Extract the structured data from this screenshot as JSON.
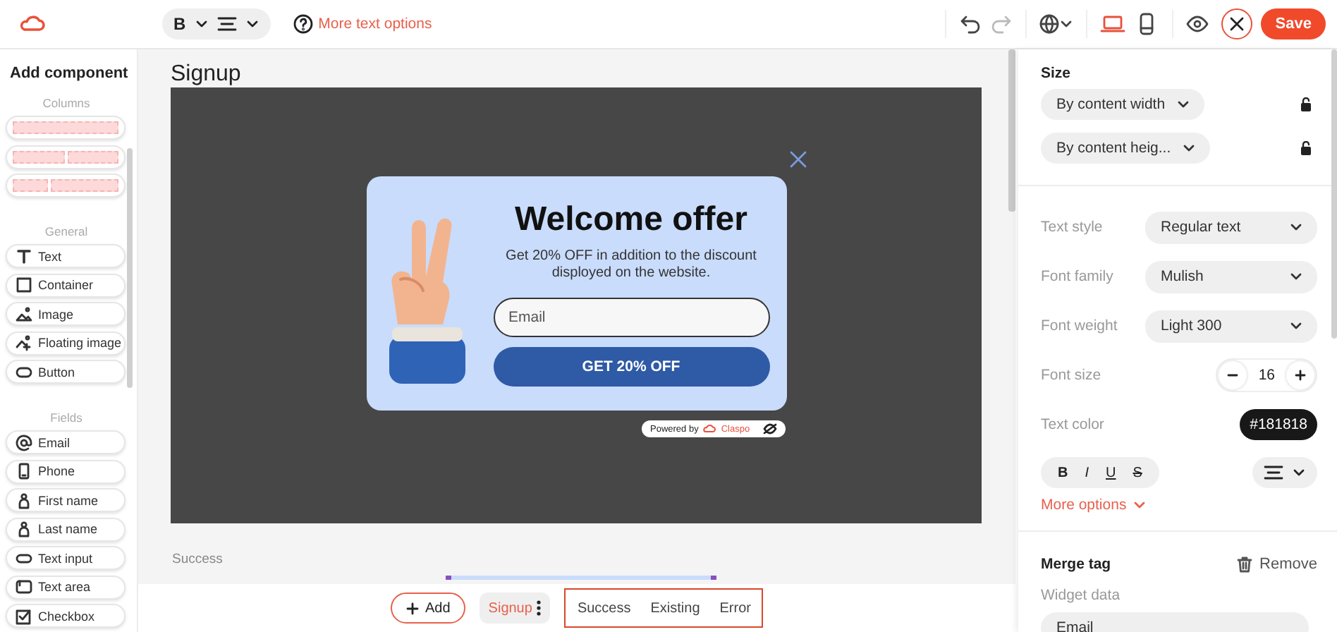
{
  "toolbar": {
    "format": {
      "bold_label": "B"
    },
    "help_link": "More text options",
    "history": [
      {
        "kind": "undo",
        "disabled": false
      },
      {
        "kind": "redo",
        "disabled": true
      }
    ],
    "devices": [
      {
        "kind": "desktop",
        "selected": true
      },
      {
        "kind": "mobile",
        "selected": false
      }
    ],
    "save": "Save"
  },
  "sidebar": {
    "title": "Add component",
    "sections": [
      {
        "heading": "Columns",
        "items": [
          {
            "kind": "single"
          },
          {
            "kind": "halves"
          },
          {
            "kind": "split"
          }
        ]
      },
      {
        "heading": "General",
        "items": [
          {
            "kind": "text",
            "label": "Text"
          },
          {
            "kind": "container",
            "label": "Container"
          },
          {
            "kind": "image",
            "label": "Image"
          },
          {
            "kind": "floating",
            "label": "Floating image"
          },
          {
            "kind": "button",
            "label": "Button"
          }
        ]
      },
      {
        "heading": "Fields",
        "items": [
          {
            "kind": "email",
            "label": "Email"
          },
          {
            "kind": "phone",
            "label": "Phone"
          },
          {
            "kind": "person",
            "label": "First name"
          },
          {
            "kind": "person",
            "label": "Last name"
          },
          {
            "kind": "input",
            "label": "Text input"
          },
          {
            "kind": "textarea",
            "label": "Text area"
          },
          {
            "kind": "checkbox",
            "label": "Checkbox"
          }
        ]
      }
    ]
  },
  "canvas": {
    "section_label": "Signup",
    "popup": {
      "title": "Welcome offer",
      "text": "Get 20% OFF in addition to the discount disployed on the website.",
      "email_placeholder": "Email",
      "button": "GET 20% OFF"
    },
    "powered": {
      "prefix": "Powered by",
      "brand": "Claspo"
    },
    "next_label": "Success"
  },
  "bottom_bar": {
    "add": "Add",
    "tabs": [
      {
        "label": "Signup",
        "selected": true
      },
      {
        "label": "Success",
        "selected": false
      },
      {
        "label": "Existing",
        "selected": false
      },
      {
        "label": "Error",
        "selected": false
      }
    ]
  },
  "panel": {
    "size": {
      "title": "Size",
      "dropdowns": [
        "By content width",
        "By content heig..."
      ]
    },
    "rows": [
      {
        "kind": "select",
        "label": "Text style",
        "value": "Regular text"
      },
      {
        "kind": "select",
        "label": "Font family",
        "value": "Mulish"
      },
      {
        "kind": "select",
        "label": "Font weight",
        "value": "Light 300"
      },
      {
        "kind": "stepper",
        "label": "Font size",
        "value": "16"
      },
      {
        "kind": "color",
        "label": "Text color",
        "value": "#181818"
      }
    ],
    "styles": [
      {
        "kind": "bold",
        "label": "B"
      },
      {
        "kind": "italic",
        "label": "I"
      },
      {
        "kind": "underline",
        "label": "U"
      },
      {
        "kind": "strike",
        "label": "S"
      }
    ],
    "more": "More options",
    "merge": {
      "title": "Merge tag",
      "remove": "Remove",
      "field_label": "Widget data",
      "value": "Email"
    }
  }
}
